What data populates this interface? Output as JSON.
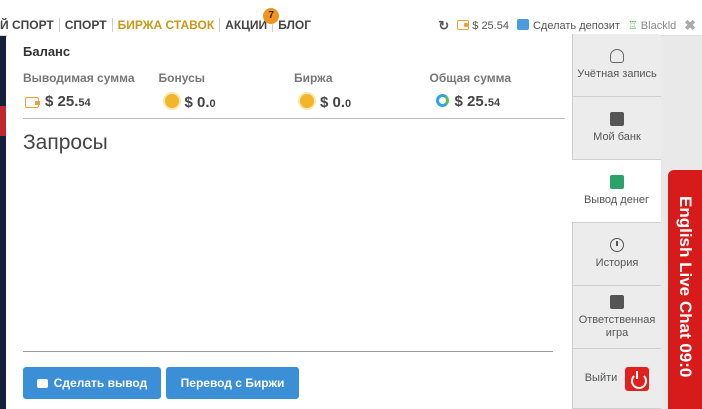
{
  "nav": {
    "items": [
      "Й СПОРТ",
      "СПОРТ",
      "БИРЖА СТАВОК",
      "АКЦИИ",
      "БЛОГ"
    ],
    "promo_badge": "7"
  },
  "header": {
    "balance": "$ 25.54",
    "deposit_label": "Сделать депозит",
    "username": "Blackld"
  },
  "balance": {
    "title": "Баланс",
    "withdrawable": {
      "label": "Выводимая сумма",
      "value": "$ 25.",
      "cents": "54"
    },
    "bonuses": {
      "label": "Бонусы",
      "value": "$ 0.",
      "cents": "0"
    },
    "exchange": {
      "label": "Биржа",
      "value": "$ 0.",
      "cents": "0"
    },
    "total": {
      "label": "Общая сумма",
      "value": "$ 25.",
      "cents": "54"
    }
  },
  "requests_title": "Запросы",
  "buttons": {
    "withdraw": "Сделать вывод",
    "transfer": "Перевод с Биржи"
  },
  "side_menu": {
    "account": "Учётная запись",
    "bank": "Мой банк",
    "withdraw": "Вывод денег",
    "history": "История",
    "responsible": "Ответственная игра",
    "logout": "Выйти"
  },
  "chat": {
    "label": "English Live Chat 09:0"
  },
  "colors": {
    "accent": "#c69a18",
    "button": "#3a8fd6",
    "chat": "#d71b1b",
    "logout": "#e32020"
  }
}
